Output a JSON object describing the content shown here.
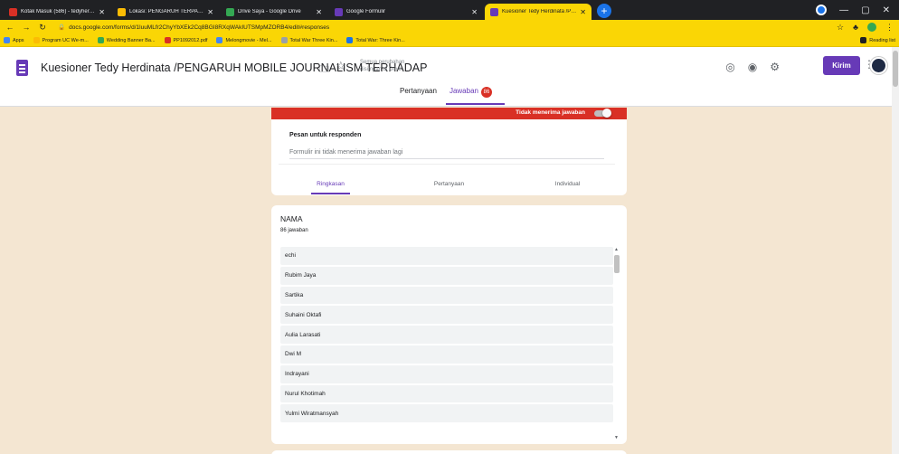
{
  "browser": {
    "tabs": [
      {
        "title": "Kotak Masuk (586) - tedyherdina",
        "favicon_color": "#d93025",
        "active": false
      },
      {
        "title": "Lokasi: PENGARUH TERPAAN CT",
        "favicon_color": "#fbbc04",
        "active": false
      },
      {
        "title": "Drive Saya - Google Drive",
        "favicon_color": "#34a853",
        "active": false
      },
      {
        "title": "Google Formulir",
        "favicon_color": "#673ab7",
        "active": false
      },
      {
        "title": "Kuesioner Tedy Herdinata /PENG",
        "favicon_color": "#673ab7",
        "active": true
      }
    ],
    "new_tab": "+",
    "url": "docs.google.com/forms/d/1luuMLfr2ChyYbXEk2Cq8BGI8RXqWAkIUTSMpMZORB4/edit#responses",
    "bookmarks": [
      {
        "label": "Apps",
        "color": "#4285f4"
      },
      {
        "label": "Program UC We-m...",
        "color": "#fbbc04"
      },
      {
        "label": "Wedding Banner Ba...",
        "color": "#34a853"
      },
      {
        "label": "PP1092012.pdf",
        "color": "#d93025"
      },
      {
        "label": "Melongmovie - Mel...",
        "color": "#4285f4"
      },
      {
        "label": "Total War Three Kin...",
        "color": "#9aa0a6"
      },
      {
        "label": "Total War: Three Kin...",
        "color": "#1a73e8"
      }
    ],
    "reading_list": "Reading list"
  },
  "header": {
    "title": "Kuesioner Tedy Herdinata /PENGARUH MOBILE JOURNALISM TERHADAP",
    "save_status": "Semua perubahan disimpan di Drive",
    "send_label": "Kirim",
    "tabs": [
      {
        "label": "Pertanyaan",
        "active": false
      },
      {
        "label": "Jawaban",
        "active": true,
        "badge": "86"
      }
    ]
  },
  "responses": {
    "not_accepting": "Tidak menerima jawaban",
    "message_label": "Pesan untuk responden",
    "message_value": "Formulir ini tidak menerima jawaban lagi",
    "sub_tabs": [
      {
        "label": "Ringkasan",
        "active": true
      },
      {
        "label": "Pertanyaan",
        "active": false
      },
      {
        "label": "Individual",
        "active": false
      }
    ]
  },
  "question": {
    "title": "NAMA",
    "count": "86 jawaban",
    "answers": [
      "echi",
      "Rubim Jaya",
      "Sartika",
      "Suhaini Oktafi",
      "Aulia Larasati",
      "Dwi M",
      "Indrayani",
      "Nurul Khotimah",
      "Yulmi Wiratmansyah"
    ]
  },
  "colors": {
    "accent": "#673ab7",
    "page_bg": "#f4e6d2",
    "closed_bar": "#d93025"
  }
}
